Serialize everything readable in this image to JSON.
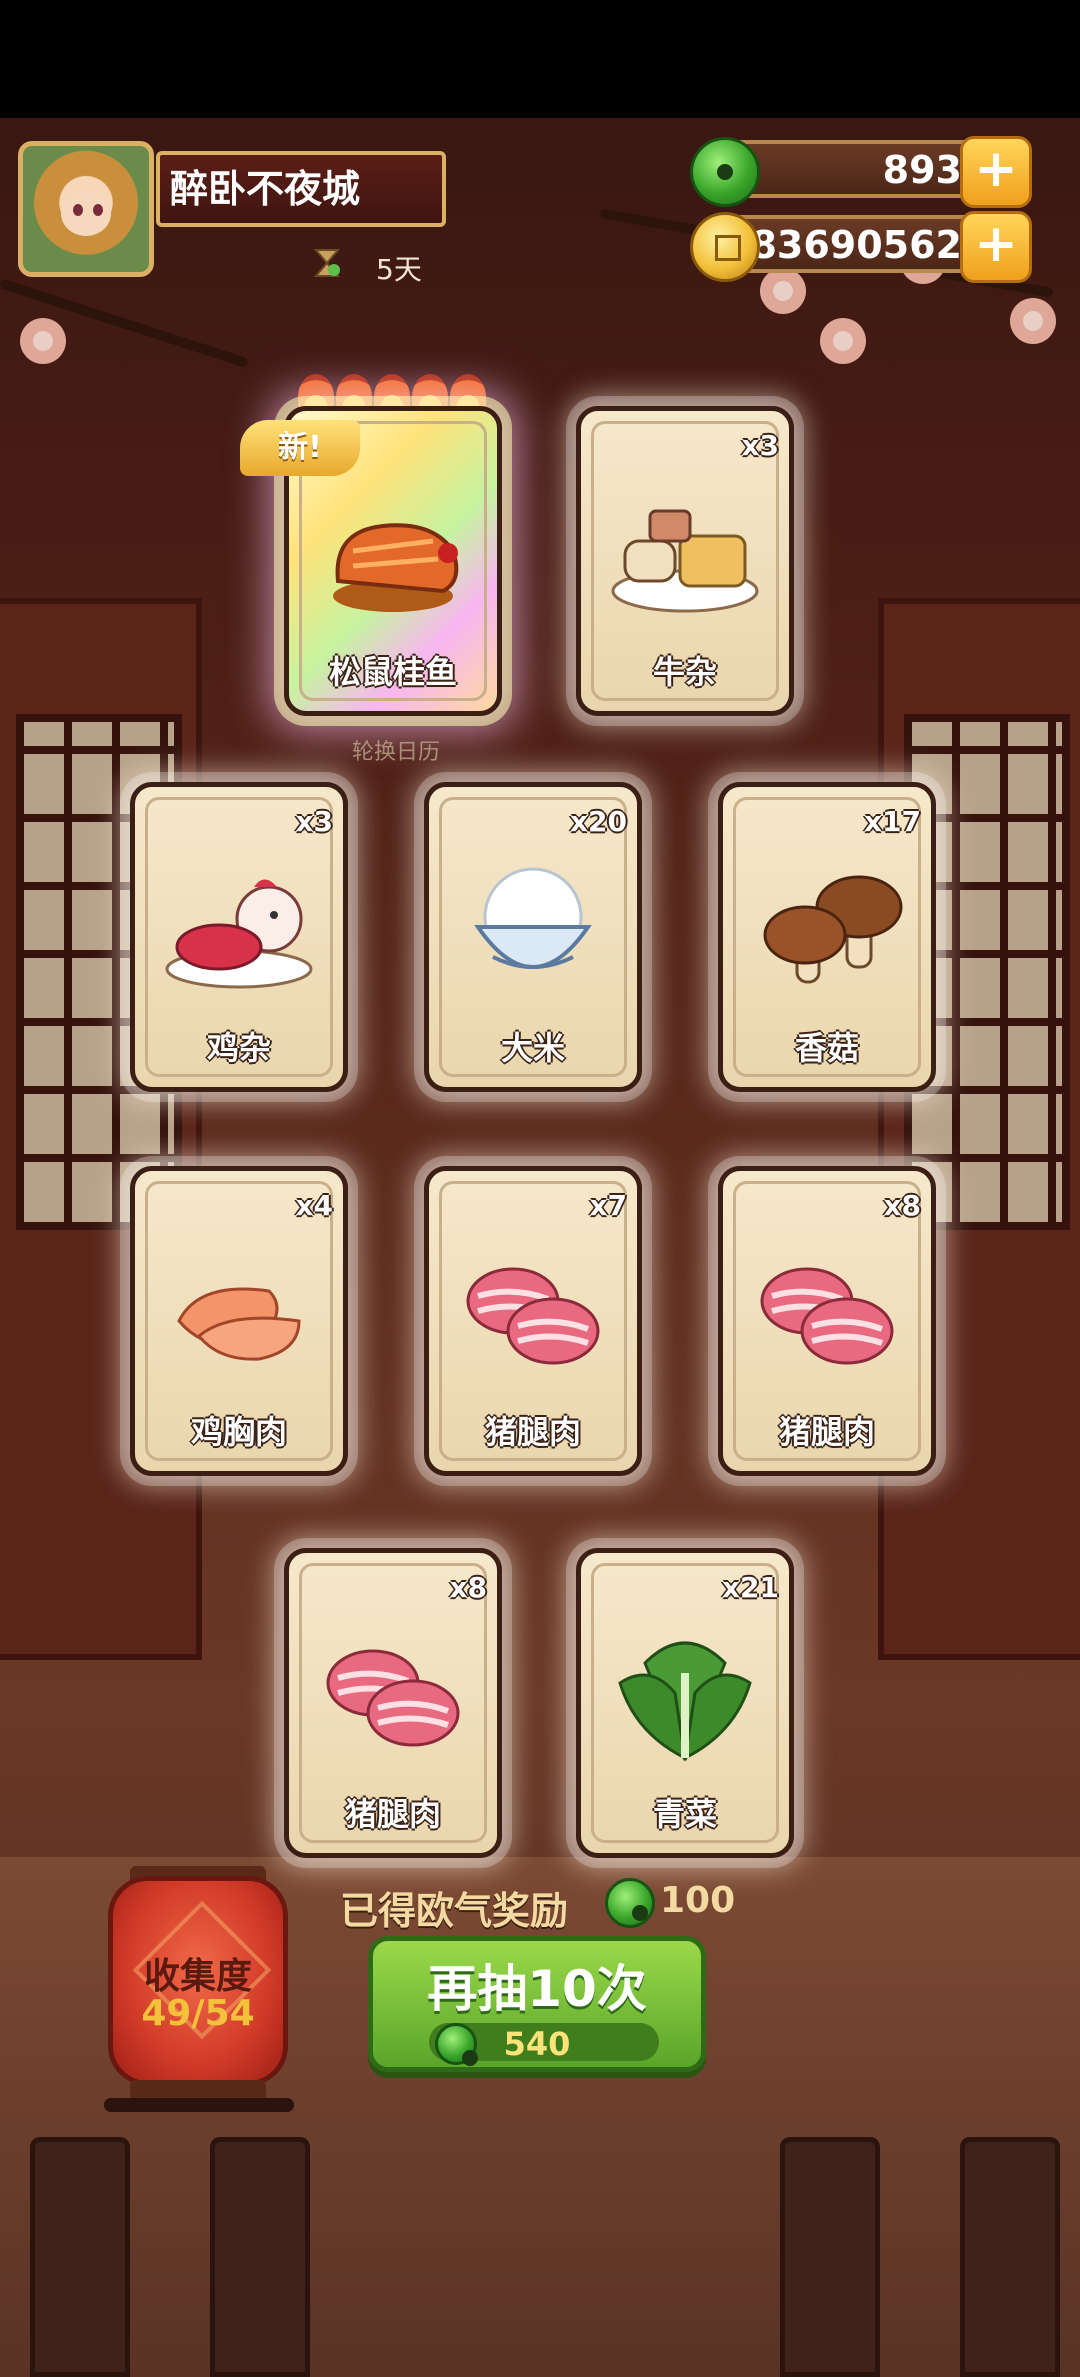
{
  "header": {
    "player_name": "醉卧不夜城",
    "days": "5天"
  },
  "currency": {
    "jade_value": "893",
    "gold_value": "83690562",
    "plus_label": "+"
  },
  "featured": {
    "new_badge": "新!",
    "calendar_label": "轮换日历",
    "flame_count": 5
  },
  "cards": [
    {
      "label": "松鼠桂鱼",
      "count": "",
      "icon": "fish-dish-icon"
    },
    {
      "label": "牛杂",
      "count": "x3",
      "icon": "beef-offal-icon"
    },
    {
      "label": "鸡杂",
      "count": "x3",
      "icon": "chicken-offal-icon"
    },
    {
      "label": "大米",
      "count": "x20",
      "icon": "rice-bowl-icon"
    },
    {
      "label": "香菇",
      "count": "x17",
      "icon": "mushroom-icon"
    },
    {
      "label": "鸡胸肉",
      "count": "x4",
      "icon": "chicken-breast-icon"
    },
    {
      "label": "猪腿肉",
      "count": "x7",
      "icon": "pork-leg-icon"
    },
    {
      "label": "猪腿肉",
      "count": "x8",
      "icon": "pork-leg-icon"
    },
    {
      "label": "猪腿肉",
      "count": "x8",
      "icon": "pork-leg-icon"
    },
    {
      "label": "青菜",
      "count": "x21",
      "icon": "greens-icon"
    }
  ],
  "reward": {
    "text": "已得欧气奖励",
    "value": "100"
  },
  "draw_button": {
    "title": "再抽10次",
    "cost": "540"
  },
  "collection": {
    "label": "收集度",
    "progress": "49/54"
  },
  "colors": {
    "button_green": "#5aa52a",
    "jade": "#3aa52a",
    "gold": "#f3c13a",
    "lantern_red": "#d23a28"
  }
}
